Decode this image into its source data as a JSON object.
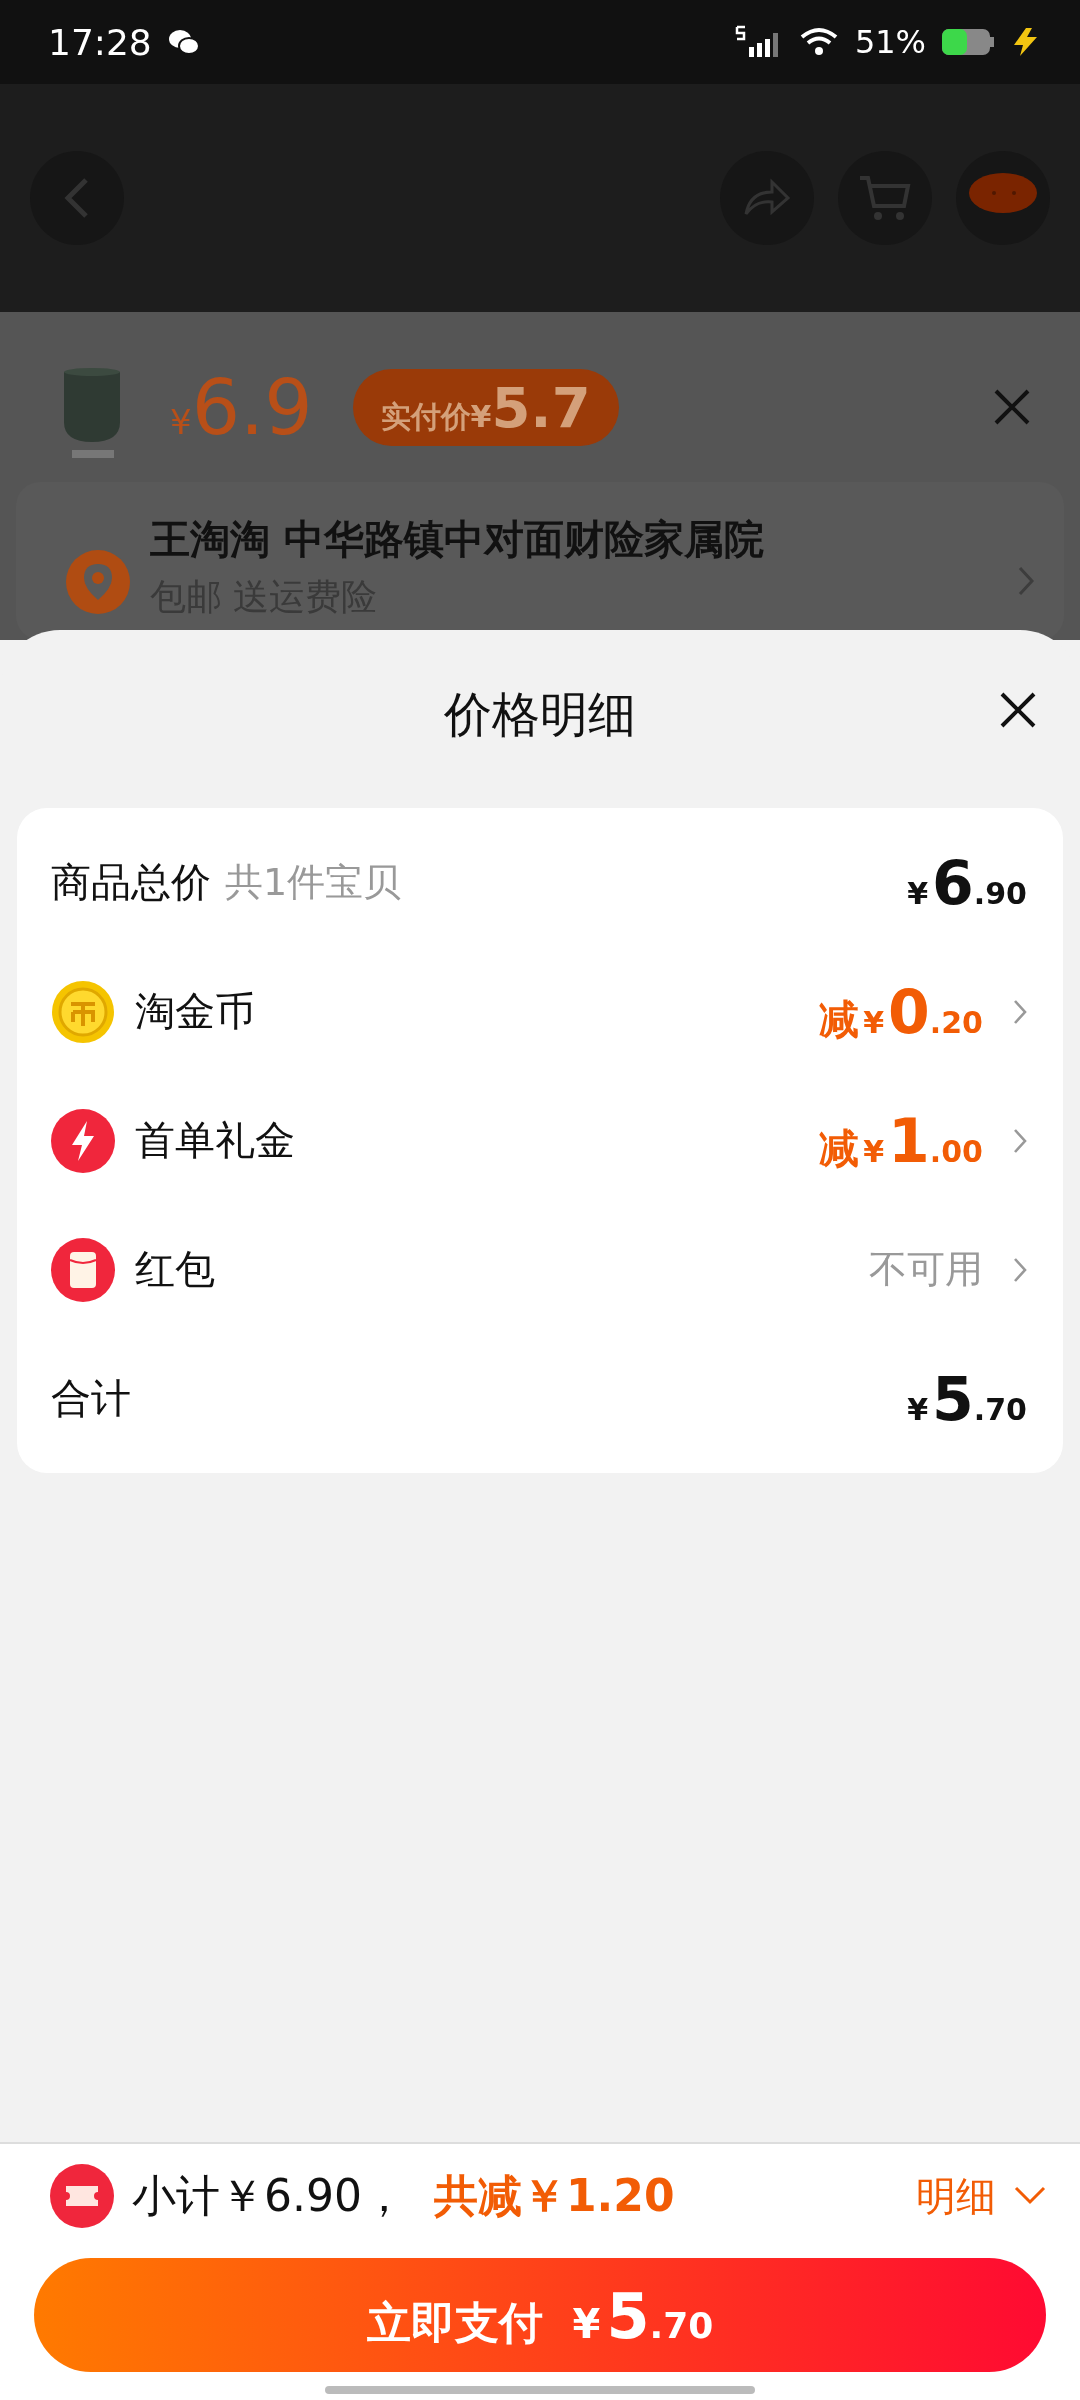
{
  "status_bar": {
    "time": "17:28",
    "battery": "51%"
  },
  "product": {
    "price": {
      "currency": "¥",
      "amount": "6.9"
    },
    "badge": {
      "label": "实付价",
      "currency": "¥",
      "amount": "5.7"
    }
  },
  "address": {
    "line": "王淘淘 中华路镇中对面财险家属院",
    "sub": "包邮 送运费险"
  },
  "sheet": {
    "title": "价格明细",
    "rows": [
      {
        "kind": "total",
        "label": "商品总价",
        "note": "共1件宝贝",
        "currency": "¥",
        "integer": "6",
        "decimal": ".90"
      },
      {
        "kind": "discount",
        "label": "淘金币",
        "prefix": "减",
        "currency": "¥",
        "integer": "0",
        "decimal": ".20"
      },
      {
        "kind": "discount",
        "label": "首单礼金",
        "prefix": "减",
        "currency": "¥",
        "integer": "1",
        "decimal": ".00"
      },
      {
        "kind": "status",
        "label": "红包",
        "status": "不可用"
      },
      {
        "kind": "total",
        "label": "合计",
        "currency": "¥",
        "integer": "5",
        "decimal": ".70"
      }
    ]
  },
  "footer": {
    "subtotal": "小计￥6.90，",
    "saved": "共减￥1.20",
    "details": "明细",
    "pay": {
      "label": "立即支付",
      "currency": "¥",
      "integer": "5",
      "decimal": ".70"
    }
  }
}
